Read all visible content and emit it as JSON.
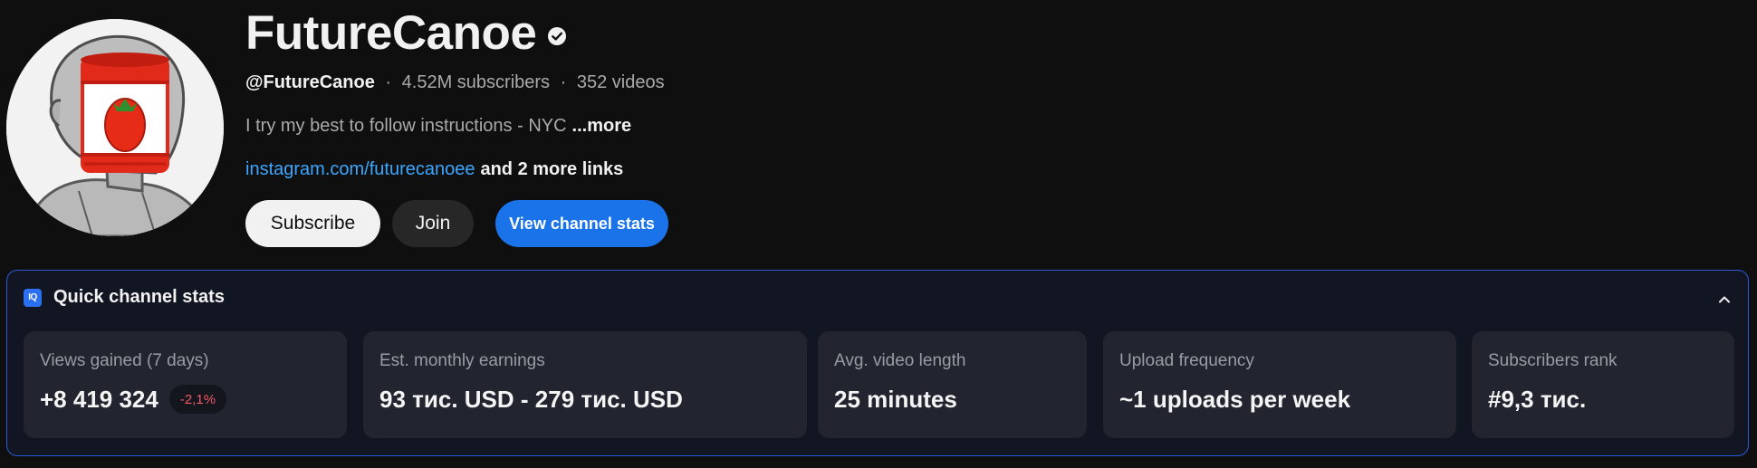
{
  "channel": {
    "name": "FutureCanoe",
    "handle": "@FutureCanoe",
    "subscribers": "4.52M subscribers",
    "videos": "352 videos",
    "separator": "·",
    "description": "I try my best to follow instructions - NYC",
    "description_more": "...more",
    "link": "instagram.com/futurecanoee",
    "more_links": "and 2 more links"
  },
  "buttons": {
    "subscribe": "Subscribe",
    "join": "Join",
    "view_stats": "View channel stats"
  },
  "quick_stats": {
    "icon_text": "IQ",
    "title": "Quick channel stats",
    "cards": [
      {
        "label": "Views gained (7 days)",
        "value": "+8 419 324",
        "change": "-2,1%"
      },
      {
        "label": "Est. monthly earnings",
        "value": "93 тис. USD - 279 тис. USD"
      },
      {
        "label": "Avg. video length",
        "value": "25 minutes"
      },
      {
        "label": "Upload frequency",
        "value": "~1 uploads per week"
      },
      {
        "label": "Subscribers rank",
        "value": "#9,3 тис."
      }
    ]
  },
  "colors": {
    "background": "#0f0f0f",
    "link": "#3ea6ff",
    "accent_button": "#1a73e8",
    "panel_border": "#2a5bd7",
    "negative_change": "#f25767"
  },
  "icons": {
    "verified": "verified-check-icon",
    "collapse": "chevron-up-icon",
    "panel": "iq-logo-icon"
  }
}
